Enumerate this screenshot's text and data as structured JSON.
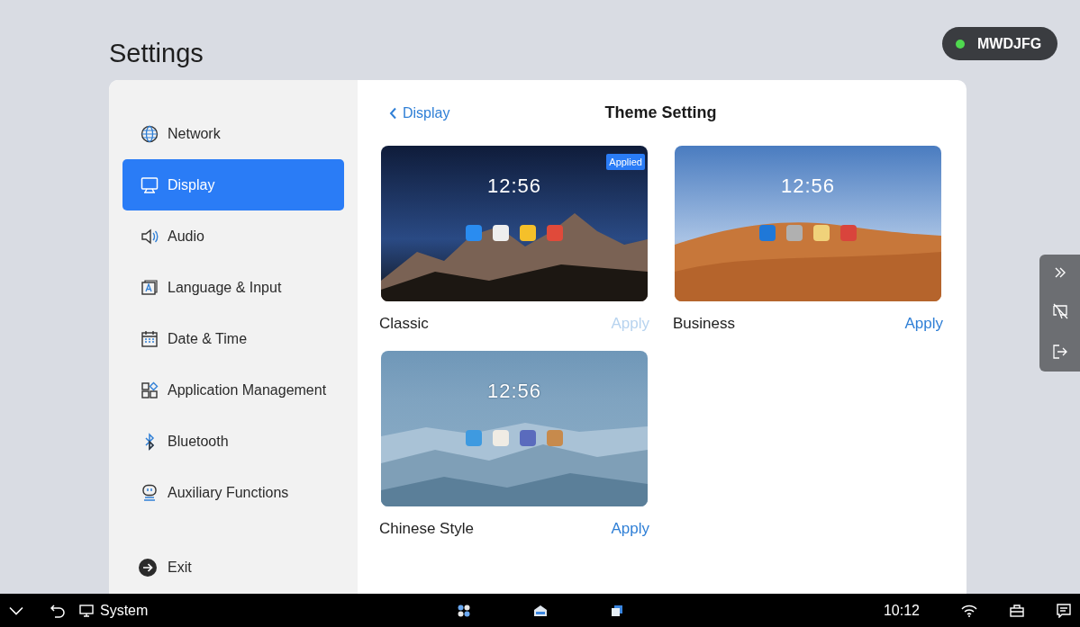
{
  "page_title": "Settings",
  "device_badge": {
    "label": "MWDJFG",
    "online": true
  },
  "sidebar": {
    "items": [
      {
        "label": "Network",
        "selected": false
      },
      {
        "label": "Display",
        "selected": true
      },
      {
        "label": "Audio",
        "selected": false
      },
      {
        "label": "Language & Input",
        "selected": false
      },
      {
        "label": "Date & Time",
        "selected": false
      },
      {
        "label": "Application Management",
        "selected": false
      },
      {
        "label": "Bluetooth",
        "selected": false
      },
      {
        "label": "Auxiliary Functions",
        "selected": false
      }
    ],
    "exit": "Exit"
  },
  "header": {
    "back": "Display",
    "title": "Theme Setting"
  },
  "themes": [
    {
      "name": "Classic",
      "kind": "night",
      "clock": "12:56",
      "badge": "Applied",
      "applied": true,
      "action": "Apply"
    },
    {
      "name": "Business",
      "kind": "desert",
      "clock": "12:56",
      "applied": false,
      "action": "Apply"
    },
    {
      "name": "Chinese Style",
      "kind": "mist",
      "clock": "12:56",
      "applied": false,
      "action": "Apply"
    }
  ],
  "taskbar": {
    "app_label": "System",
    "time": "10:12"
  }
}
